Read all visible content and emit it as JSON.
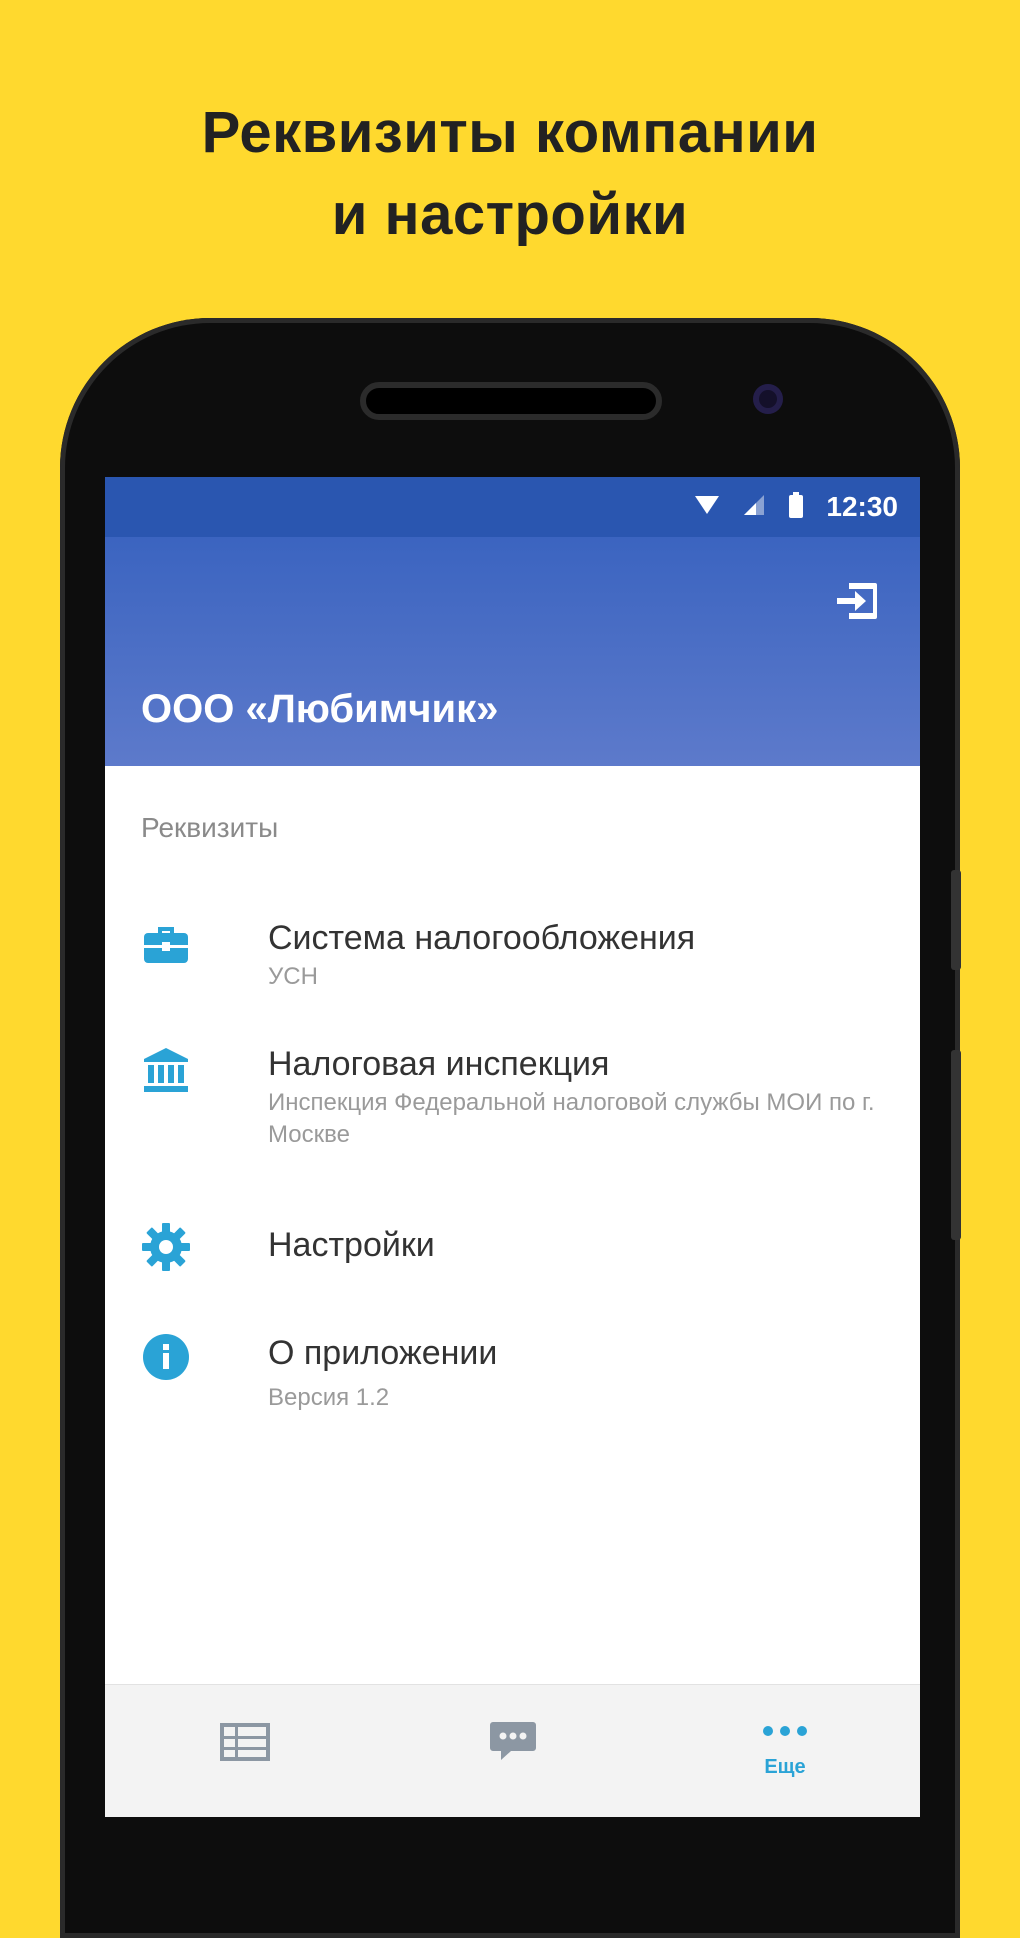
{
  "promo": {
    "title_line1": "Реквизиты компании",
    "title_line2": "и настройки"
  },
  "status_bar": {
    "time": "12:30",
    "icons": [
      "wifi-icon",
      "signal-icon",
      "battery-icon"
    ]
  },
  "app_bar": {
    "company_name": "ООО «Любимчик»",
    "action_icon": "exit-icon"
  },
  "section": {
    "header": "Реквизиты"
  },
  "menu": [
    {
      "icon": "briefcase-icon",
      "title": "Система налогообложения",
      "subtitle": "УСН"
    },
    {
      "icon": "bank-icon",
      "title": "Налоговая инспекция",
      "subtitle": "Инспекция Федеральной налоговой службы МОИ по г. Москве"
    },
    {
      "icon": "gear-icon",
      "title": "Настройки",
      "subtitle": ""
    },
    {
      "icon": "info-icon",
      "title": "О приложении",
      "subtitle": "Версия 1.2"
    }
  ],
  "bottom_nav": {
    "tabs": [
      {
        "icon": "list-icon",
        "label": "",
        "active": false
      },
      {
        "icon": "chat-icon",
        "label": "",
        "active": false
      },
      {
        "icon": "more-icon",
        "label": "Еще",
        "active": true
      }
    ]
  },
  "colors": {
    "background": "#FFD92E",
    "app_bar_top": "#3b64c0",
    "app_bar_bottom": "#5d7acb",
    "accent": "#2aa3d6",
    "icon_gray": "#8c97a3"
  }
}
